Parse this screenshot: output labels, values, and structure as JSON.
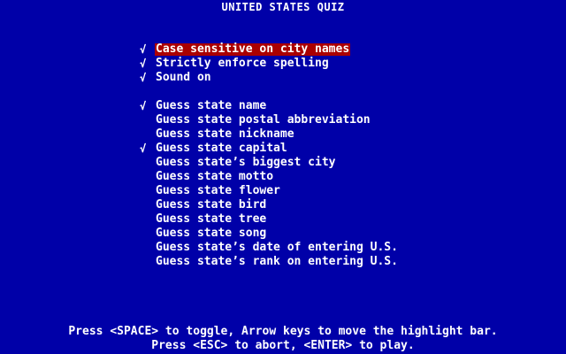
{
  "title": "UNITED STATES QUIZ",
  "check_glyph": "√",
  "options": [
    {
      "label": "Case sensitive on city names",
      "checked": true,
      "highlighted": true,
      "group_start": false
    },
    {
      "label": "Strictly enforce spelling",
      "checked": true,
      "highlighted": false,
      "group_start": false
    },
    {
      "label": "Sound on",
      "checked": true,
      "highlighted": false,
      "group_start": false
    },
    {
      "label": "Guess state name",
      "checked": true,
      "highlighted": false,
      "group_start": true
    },
    {
      "label": "Guess state postal abbreviation",
      "checked": false,
      "highlighted": false,
      "group_start": false
    },
    {
      "label": "Guess state nickname",
      "checked": false,
      "highlighted": false,
      "group_start": false
    },
    {
      "label": "Guess state capital",
      "checked": true,
      "highlighted": false,
      "group_start": false
    },
    {
      "label": "Guess state’s biggest city",
      "checked": false,
      "highlighted": false,
      "group_start": false
    },
    {
      "label": "Guess state motto",
      "checked": false,
      "highlighted": false,
      "group_start": false
    },
    {
      "label": "Guess state flower",
      "checked": false,
      "highlighted": false,
      "group_start": false
    },
    {
      "label": "Guess state bird",
      "checked": false,
      "highlighted": false,
      "group_start": false
    },
    {
      "label": "Guess state tree",
      "checked": false,
      "highlighted": false,
      "group_start": false
    },
    {
      "label": "Guess state song",
      "checked": false,
      "highlighted": false,
      "group_start": false
    },
    {
      "label": "Guess state’s date of entering U.S.",
      "checked": false,
      "highlighted": false,
      "group_start": false
    },
    {
      "label": "Guess state’s rank on entering U.S.",
      "checked": false,
      "highlighted": false,
      "group_start": false
    }
  ],
  "footer": {
    "line1": "Press <SPACE> to toggle, Arrow keys to move the highlight bar.",
    "line2": "Press <ESC> to abort, <ENTER> to play."
  },
  "colors": {
    "background": "#0000a8",
    "text": "#ffffff",
    "highlight": "#aa0000"
  }
}
